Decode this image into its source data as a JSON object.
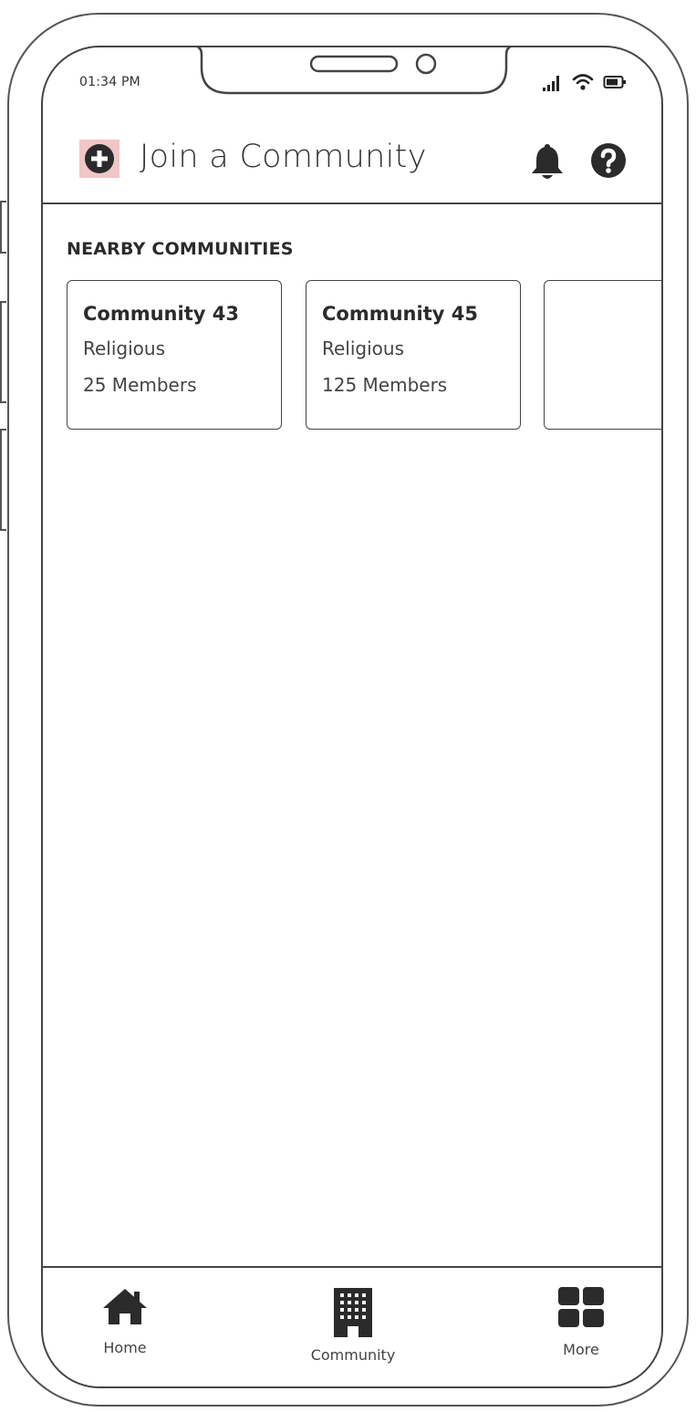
{
  "status_bar": {
    "time": "01:34 PM"
  },
  "header": {
    "title": "Join a Community",
    "add_icon": "plus-circle-icon",
    "bell_icon": "bell-icon",
    "help_icon": "question-circle-icon"
  },
  "nearby": {
    "section_title": "NEARBY COMMUNITIES",
    "communities": [
      {
        "name": "Community 43",
        "type": "Religious",
        "members": "25 Members"
      },
      {
        "name": "Community 45",
        "type": "Religious",
        "members": "125 Members"
      },
      {
        "name": "",
        "type": "",
        "members": ""
      }
    ]
  },
  "bottom_nav": {
    "items": [
      {
        "label": "Home",
        "icon": "home-icon"
      },
      {
        "label": "Community",
        "icon": "building-icon"
      },
      {
        "label": "More",
        "icon": "grid-icon"
      }
    ]
  },
  "colors": {
    "accent_highlight": "#f0c6c6",
    "frame": "#444444",
    "text": "#2b2b2b"
  }
}
